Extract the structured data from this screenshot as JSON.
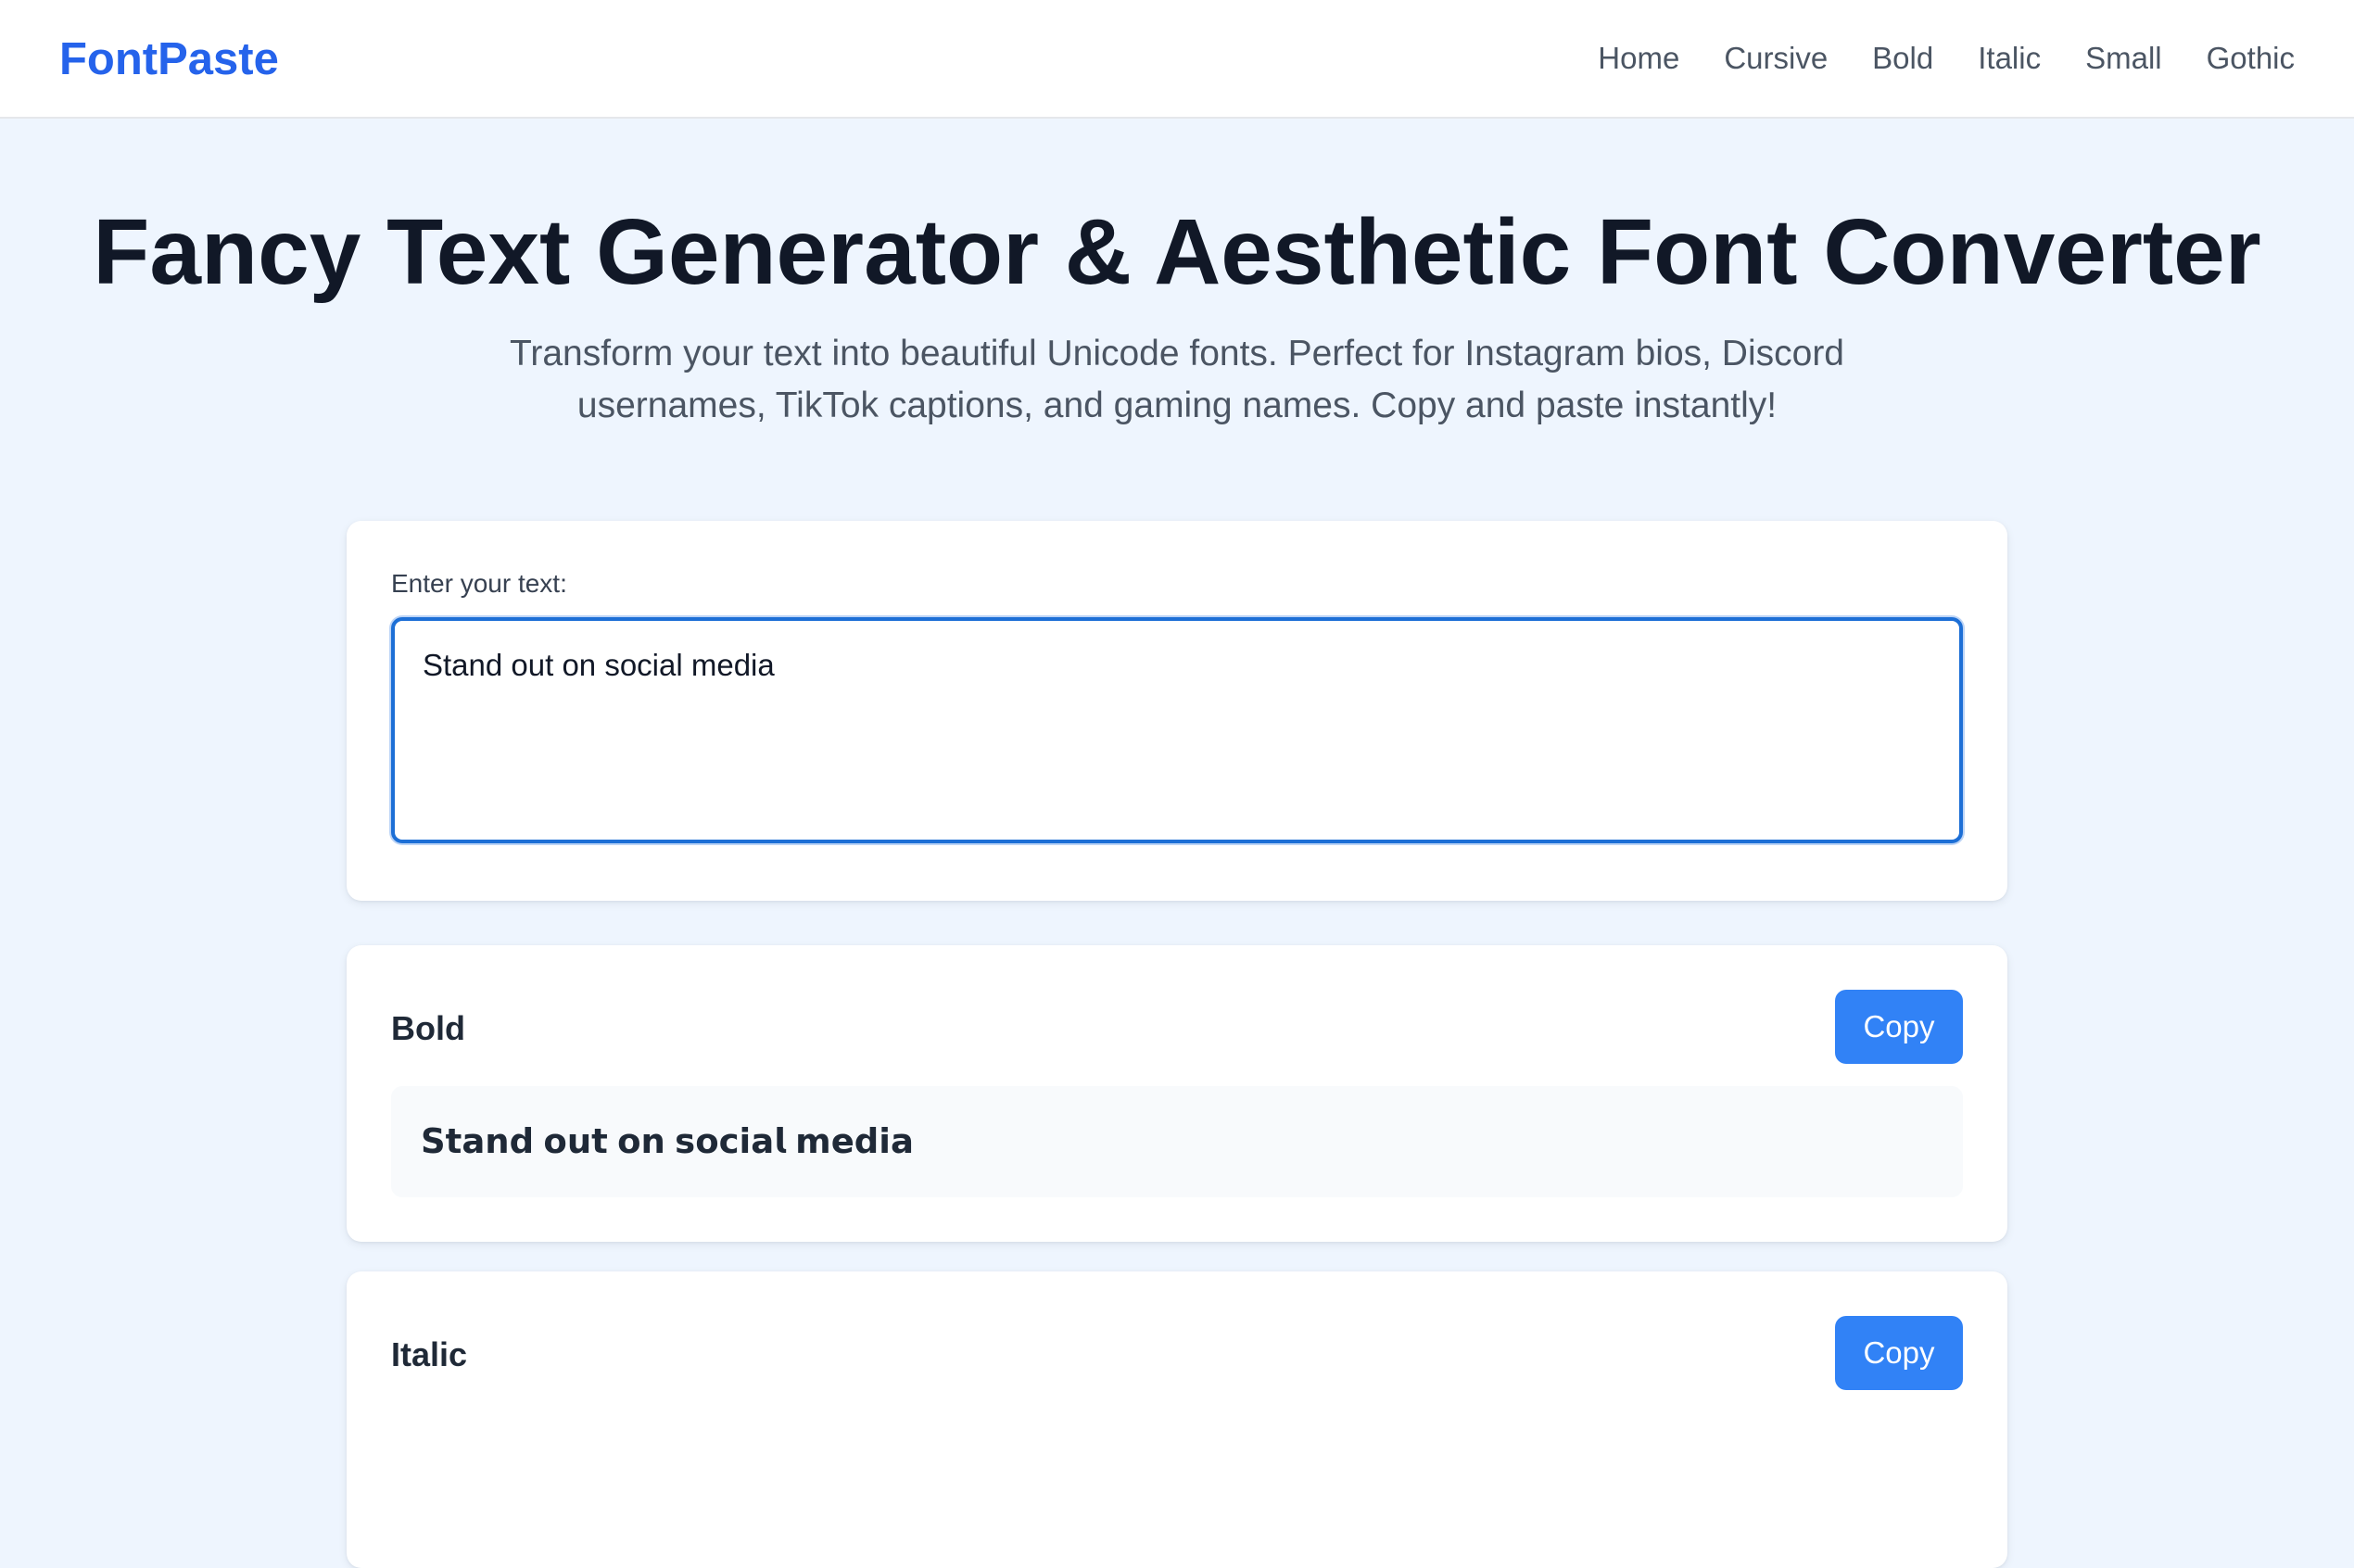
{
  "brand": {
    "logo": "FontPaste"
  },
  "nav": {
    "items": [
      {
        "label": "Home"
      },
      {
        "label": "Cursive"
      },
      {
        "label": "Bold"
      },
      {
        "label": "Italic"
      },
      {
        "label": "Small"
      },
      {
        "label": "Gothic"
      }
    ]
  },
  "hero": {
    "title": "Fancy Text Generator & Aesthetic Font Converter",
    "subtitle": "Transform your text into beautiful Unicode fonts. Perfect for Instagram bios, Discord usernames, TikTok captions, and gaming names. Copy and paste instantly!"
  },
  "input": {
    "label": "Enter your text:",
    "value": "Stand out on social media"
  },
  "results": [
    {
      "name": "Bold",
      "copy_label": "Copy",
      "preview": "𝗦𝘁𝗮𝗻𝗱 𝗼𝘂𝘁 𝗼𝗻 𝘀𝗼𝗰𝗶𝗮𝗹 𝗺𝗲𝗱𝗶𝗮"
    },
    {
      "name": "Italic",
      "copy_label": "Copy"
    }
  ],
  "colors": {
    "brand": "#2563eb",
    "button": "#3182f6",
    "page_background": "#eef5fe",
    "input_focus_border": "#1d6fd6"
  }
}
